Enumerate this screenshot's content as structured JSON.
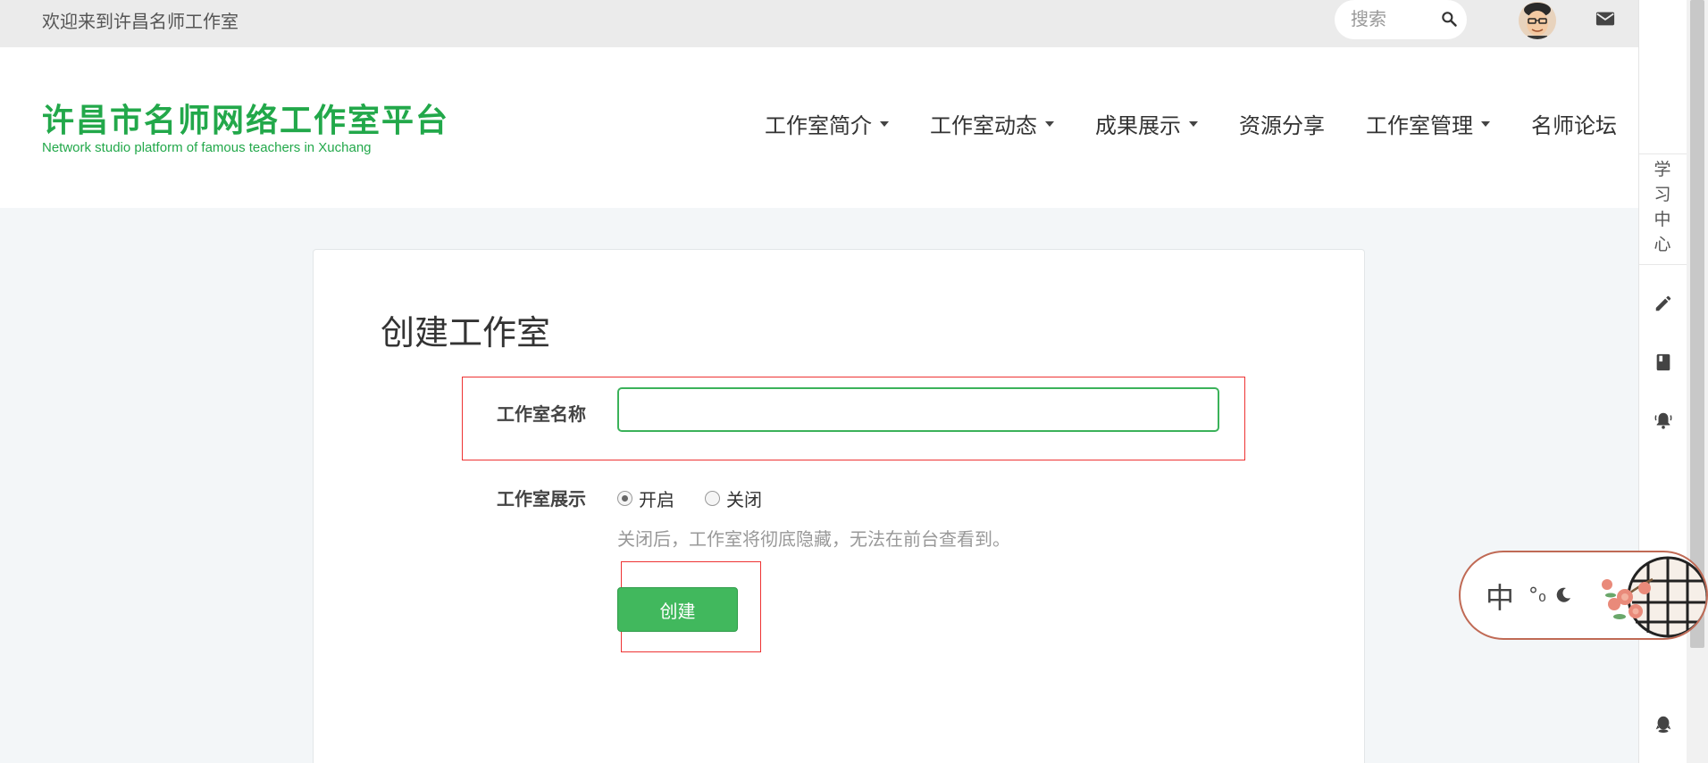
{
  "topbar": {
    "welcome": "欢迎来到许昌名师工作室",
    "search_placeholder": "搜索"
  },
  "logo": {
    "cn": "许昌市名师网络工作室平台",
    "en": "Network studio platform of famous teachers in Xuchang"
  },
  "nav": {
    "items": [
      {
        "label": "工作室简介",
        "dropdown": true
      },
      {
        "label": "工作室动态",
        "dropdown": true
      },
      {
        "label": "成果展示",
        "dropdown": true
      },
      {
        "label": "资源分享",
        "dropdown": false
      },
      {
        "label": "工作室管理",
        "dropdown": true
      },
      {
        "label": "名师论坛",
        "dropdown": false
      }
    ]
  },
  "form": {
    "title": "创建工作室",
    "name_label": "工作室名称",
    "name_value": "",
    "display_label": "工作室展示",
    "options": [
      {
        "label": "开启",
        "checked": true
      },
      {
        "label": "关闭",
        "checked": false
      }
    ],
    "hint": "关闭后，工作室将彻底隐藏，无法在前台查看到。",
    "submit_label": "创建"
  },
  "sidebar": {
    "study_label": "学习中心",
    "icons": [
      "pencil-icon",
      "book-icon",
      "bell-icon",
      "qq-icon"
    ]
  },
  "float_tool": {
    "lang": "中",
    "percent": "°₀"
  },
  "colors": {
    "brand_green": "#22a84a",
    "button_green": "#41b85d",
    "highlight_red": "#e33"
  }
}
